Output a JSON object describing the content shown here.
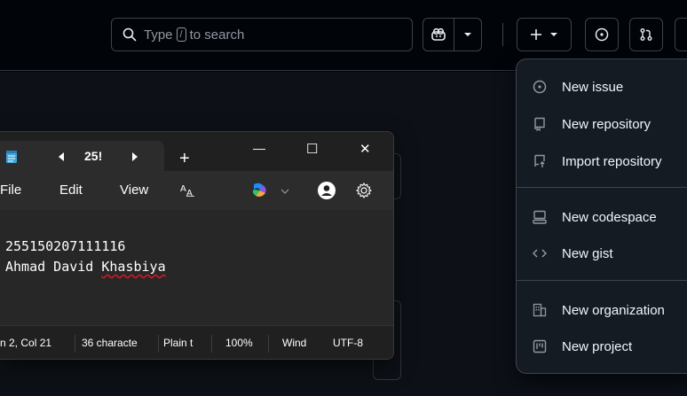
{
  "github": {
    "search": {
      "type_label": "Type",
      "key": "/",
      "suffix": "to search"
    },
    "header_buttons": [
      "copilot",
      "copilot-dropdown",
      "create-new",
      "issues",
      "pull-requests"
    ],
    "create_menu": {
      "items": [
        {
          "label": "New issue",
          "icon": "issue-opened-icon"
        },
        {
          "label": "New repository",
          "icon": "repo-icon"
        },
        {
          "label": "Import repository",
          "icon": "repo-push-icon"
        },
        {
          "label": "New codespace",
          "icon": "codespaces-icon"
        },
        {
          "label": "New gist",
          "icon": "code-icon"
        },
        {
          "label": "New organization",
          "icon": "organization-icon"
        },
        {
          "label": "New project",
          "icon": "project-icon"
        }
      ]
    }
  },
  "notepad": {
    "tab_title": "25!",
    "window_controls": {
      "minimize": "—",
      "maximize": "☐",
      "close": "✕"
    },
    "new_tab": "+",
    "menu": {
      "file": "File",
      "edit": "Edit",
      "view": "View"
    },
    "content": {
      "line1": "255150207111116",
      "line2_first": "Ahmad David ",
      "line2_squiggle": "Khasbiya"
    },
    "status": {
      "position": "n 2, Col 21",
      "chars": "36 characte",
      "format": "Plain t",
      "zoom": "100%",
      "line_ending": "Wind",
      "encoding": "UTF-8"
    }
  },
  "colors": {
    "accent": "#4493f8",
    "menu_bg": "#151b23",
    "notepad_bg": "#202020"
  }
}
